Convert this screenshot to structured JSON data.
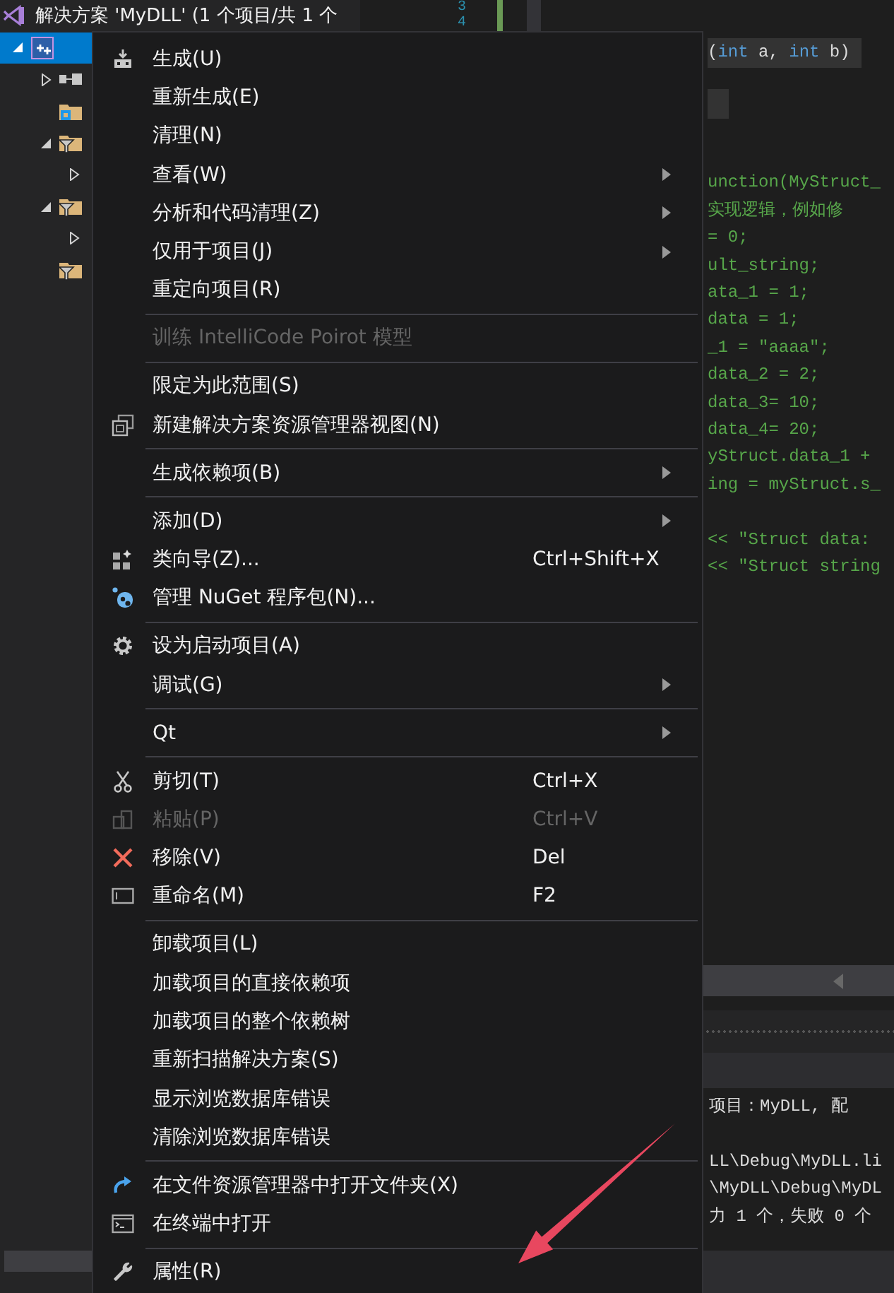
{
  "solution_explorer": {
    "title": "解决方案 'MyDLL' (1 个项目/共 1 个",
    "project": {
      "selected": true,
      "expanded": true,
      "children": [
        {
          "kind": "references",
          "expanded": false
        },
        {
          "kind": "folder"
        },
        {
          "kind": "filter",
          "expanded": true,
          "children": [
            {
              "expanded": false
            }
          ]
        },
        {
          "kind": "filter",
          "expanded": true,
          "children": [
            {
              "expanded": false
            }
          ]
        },
        {
          "kind": "filter"
        }
      ]
    }
  },
  "editor": {
    "line_numbers": [
      "3",
      "4"
    ],
    "signature": [
      {
        "kind": "plain",
        "text": "("
      },
      {
        "kind": "keyword",
        "text": "int"
      },
      {
        "kind": "plain",
        "text": " a, "
      },
      {
        "kind": "keyword",
        "text": "int"
      },
      {
        "kind": "plain",
        "text": " b)"
      }
    ],
    "code_lines": [
      "unction(MyStruct_",
      "实现逻辑，例如修",
      "= 0;",
      "ult_string;",
      "ata_1 = 1;",
      "data = 1;",
      "_1 = \"aaaa\";",
      "data_2 = 2;",
      "data_3= 10;",
      "data_4= 20;",
      "yStruct.data_1 +",
      "ing = myStruct.s_"
    ],
    "stream_lines": [
      "<< \"Struct data:",
      "<< \"Struct string"
    ]
  },
  "output": {
    "header": "项目：MyDLL, 配",
    "lines": [
      "LL\\Debug\\MyDLL.li",
      "\\MyDLL\\Debug\\MyDL",
      "力 1 个，失败 0 个"
    ]
  },
  "context_menu": {
    "items": [
      {
        "kind": "item",
        "label": "生成(U)",
        "submenu": false,
        "disabled": false
      },
      {
        "kind": "item",
        "label": "重新生成(E)",
        "submenu": false,
        "disabled": false
      },
      {
        "kind": "item",
        "label": "清理(N)",
        "submenu": false,
        "disabled": false
      },
      {
        "kind": "item",
        "label": "查看(W)",
        "submenu": true,
        "disabled": false
      },
      {
        "kind": "item",
        "label": "分析和代码清理(Z)",
        "submenu": true,
        "disabled": false
      },
      {
        "kind": "item",
        "label": "仅用于项目(J)",
        "submenu": true,
        "disabled": false
      },
      {
        "kind": "item",
        "label": "重定向项目(R)",
        "submenu": false,
        "disabled": false
      },
      {
        "kind": "separator"
      },
      {
        "kind": "item",
        "label": "训练 IntelliCode Poirot 模型",
        "submenu": false,
        "disabled": true
      },
      {
        "kind": "separator"
      },
      {
        "kind": "item",
        "label": "限定为此范围(S)",
        "submenu": false,
        "disabled": false
      },
      {
        "kind": "item",
        "label": "新建解决方案资源管理器视图(N)",
        "submenu": false,
        "disabled": false
      },
      {
        "kind": "separator"
      },
      {
        "kind": "item",
        "label": "生成依赖项(B)",
        "submenu": true,
        "disabled": false
      },
      {
        "kind": "separator"
      },
      {
        "kind": "item",
        "label": "添加(D)",
        "submenu": true,
        "disabled": false
      },
      {
        "kind": "item",
        "label": "类向导(Z)...",
        "shortcut": "Ctrl+Shift+X",
        "submenu": false,
        "disabled": false
      },
      {
        "kind": "item",
        "label": "管理 NuGet 程序包(N)...",
        "submenu": false,
        "disabled": false
      },
      {
        "kind": "separator"
      },
      {
        "kind": "item",
        "label": "设为启动项目(A)",
        "submenu": false,
        "disabled": false
      },
      {
        "kind": "item",
        "label": "调试(G)",
        "submenu": true,
        "disabled": false
      },
      {
        "kind": "separator"
      },
      {
        "kind": "item",
        "label": "Qt",
        "submenu": true,
        "disabled": false
      },
      {
        "kind": "separator"
      },
      {
        "kind": "item",
        "label": "剪切(T)",
        "shortcut": "Ctrl+X",
        "submenu": false,
        "disabled": false
      },
      {
        "kind": "item",
        "label": "粘贴(P)",
        "shortcut": "Ctrl+V",
        "submenu": false,
        "disabled": true
      },
      {
        "kind": "item",
        "label": "移除(V)",
        "shortcut": "Del",
        "submenu": false,
        "disabled": false
      },
      {
        "kind": "item",
        "label": "重命名(M)",
        "shortcut": "F2",
        "submenu": false,
        "disabled": false
      },
      {
        "kind": "separator"
      },
      {
        "kind": "item",
        "label": "卸载项目(L)",
        "submenu": false,
        "disabled": false
      },
      {
        "kind": "item",
        "label": "加载项目的直接依赖项",
        "submenu": false,
        "disabled": false
      },
      {
        "kind": "item",
        "label": "加载项目的整个依赖树",
        "submenu": false,
        "disabled": false
      },
      {
        "kind": "item",
        "label": "重新扫描解决方案(S)",
        "submenu": false,
        "disabled": false
      },
      {
        "kind": "item",
        "label": "显示浏览数据库错误",
        "submenu": false,
        "disabled": false
      },
      {
        "kind": "item",
        "label": "清除浏览数据库错误",
        "submenu": false,
        "disabled": false
      },
      {
        "kind": "separator"
      },
      {
        "kind": "item",
        "label": "在文件资源管理器中打开文件夹(X)",
        "submenu": false,
        "disabled": false
      },
      {
        "kind": "item",
        "label": "在终端中打开",
        "submenu": false,
        "disabled": false
      },
      {
        "kind": "separator"
      },
      {
        "kind": "item",
        "label": "属性(R)",
        "submenu": false,
        "disabled": false
      }
    ]
  }
}
